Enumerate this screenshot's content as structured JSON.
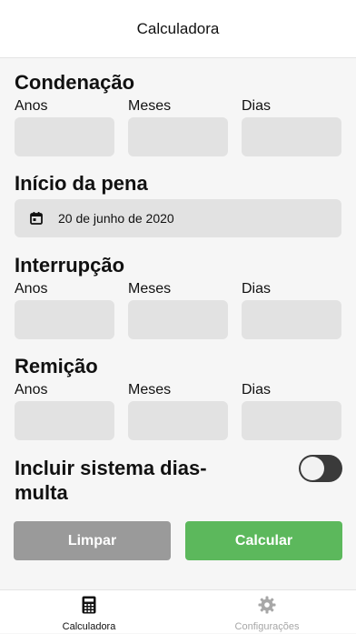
{
  "header": {
    "title": "Calculadora"
  },
  "condenacao": {
    "title": "Condenação",
    "labels": {
      "years": "Anos",
      "months": "Meses",
      "days": "Dias"
    },
    "values": {
      "years": "",
      "months": "",
      "days": ""
    }
  },
  "inicio": {
    "title": "Início da pena",
    "date": "20 de junho de 2020",
    "icon": "calendar-icon"
  },
  "interrupcao": {
    "title": "Interrupção",
    "labels": {
      "years": "Anos",
      "months": "Meses",
      "days": "Dias"
    },
    "values": {
      "years": "",
      "months": "",
      "days": ""
    }
  },
  "remicao": {
    "title": "Remição",
    "labels": {
      "years": "Anos",
      "months": "Meses",
      "days": "Dias"
    },
    "values": {
      "years": "",
      "months": "",
      "days": ""
    }
  },
  "dias_multa": {
    "label": "Incluir sistema dias-multa",
    "enabled": false
  },
  "buttons": {
    "clear": "Limpar",
    "calculate": "Calcular"
  },
  "tabbar": {
    "calculator": {
      "label": "Calculadora",
      "icon": "calculator-icon",
      "active": true
    },
    "settings": {
      "label": "Configurações",
      "icon": "gear-icon",
      "active": false
    }
  },
  "colors": {
    "accent_green": "#5cb85c",
    "clear_gray": "#9a9a9a",
    "input_bg": "#e2e2e2",
    "toggle_off": "#3a3a3a",
    "inactive_tab": "#a7a7a7"
  }
}
